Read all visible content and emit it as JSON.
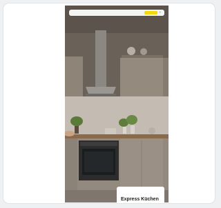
{
  "colors": {
    "background": "#eef0f2",
    "card": "#ffffff",
    "accent": "#f4d90f",
    "overlay": "#ffffff"
  },
  "top_bar": {
    "logo": "",
    "cta_label": "",
    "menu_icon": "chevron-icon"
  },
  "overlay": {
    "eyebrow": "",
    "title": "Express Küchen"
  }
}
